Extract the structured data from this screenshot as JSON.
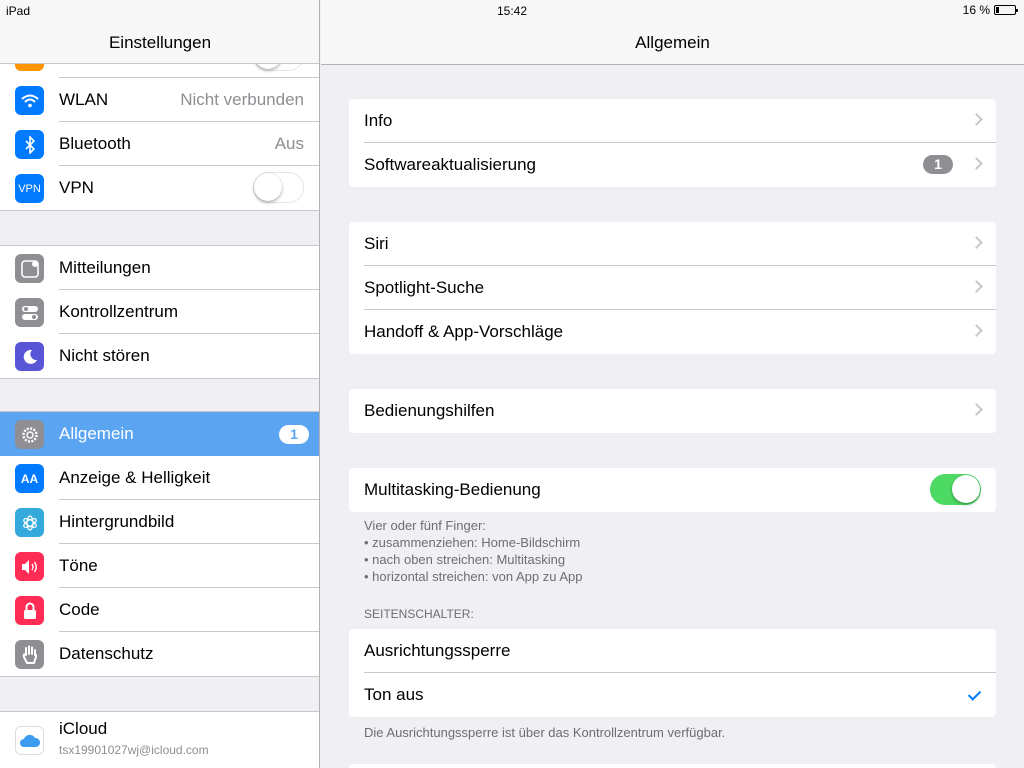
{
  "status": {
    "device": "iPad",
    "time": "15:42",
    "battery": "16 %"
  },
  "sidebar": {
    "title": "Einstellungen",
    "groups": [
      {
        "items": [
          {
            "label": "WLAN",
            "value": "Nicht verbunden",
            "icon": "wifi-icon",
            "color": "#007aff"
          },
          {
            "label": "Bluetooth",
            "value": "Aus",
            "icon": "bluetooth-icon",
            "color": "#007aff"
          },
          {
            "label": "VPN",
            "icon": "vpn-icon",
            "color": "#007aff",
            "toggle": false,
            "icon_text": "VPN"
          }
        ]
      },
      {
        "items": [
          {
            "label": "Mitteilungen",
            "icon": "notifications-icon",
            "color": "#8e8e93"
          },
          {
            "label": "Kontrollzentrum",
            "icon": "control-center-icon",
            "color": "#8e8e93"
          },
          {
            "label": "Nicht stören",
            "icon": "moon-icon",
            "color": "#5856d6"
          }
        ]
      },
      {
        "items": [
          {
            "label": "Allgemein",
            "icon": "gear-icon",
            "color": "#8e8e93",
            "badge": "1",
            "selected": true
          },
          {
            "label": "Anzeige & Helligkeit",
            "icon": "text-size-icon",
            "color": "#007aff",
            "icon_text": "AA"
          },
          {
            "label": "Hintergrundbild",
            "icon": "wallpaper-icon",
            "color": "#34aadc"
          },
          {
            "label": "Töne",
            "icon": "speaker-icon",
            "color": "#ff2d55"
          },
          {
            "label": "Code",
            "icon": "lock-icon",
            "color": "#ff2d55"
          },
          {
            "label": "Datenschutz",
            "icon": "hand-icon",
            "color": "#8e8e93"
          }
        ]
      },
      {
        "items": [
          {
            "label": "iCloud",
            "sub": "tsx19901027wj@icloud.com",
            "icon": "icloud-icon",
            "color": "#ffffff"
          }
        ]
      }
    ]
  },
  "main": {
    "title": "Allgemein",
    "groups": [
      {
        "items": [
          {
            "label": "Info"
          },
          {
            "label": "Softwareaktualisierung",
            "badge": "1"
          }
        ]
      },
      {
        "items": [
          {
            "label": "Siri"
          },
          {
            "label": "Spotlight-Suche"
          },
          {
            "label": "Handoff & App-Vorschläge"
          }
        ]
      },
      {
        "items": [
          {
            "label": "Bedienungshilfen"
          }
        ]
      },
      {
        "items": [
          {
            "label": "Multitasking-Bedienung",
            "toggle": true
          }
        ]
      }
    ],
    "multitasking_footer": [
      "Vier oder fünf Finger:",
      "• zusammenziehen: Home-Bildschirm",
      "• nach oben streichen: Multitasking",
      "• horizontal streichen: von App zu App"
    ],
    "side_switch_header": "SEITENSCHALTER:",
    "side_switch_items": [
      {
        "label": "Ausrichtungssperre"
      },
      {
        "label": "Ton aus",
        "checked": true
      }
    ],
    "side_switch_footer": "Die Ausrichtungssperre ist über das Kontrollzentrum verfügbar."
  }
}
